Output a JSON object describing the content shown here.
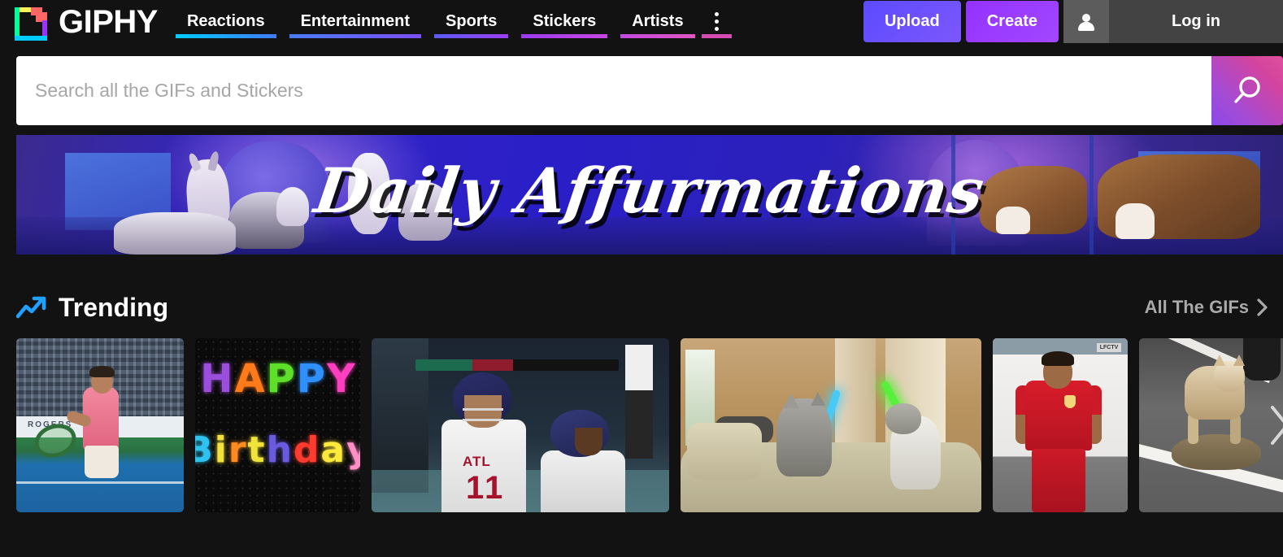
{
  "brand": {
    "name": "GIPHY",
    "logo_icon": "giphy-logo-icon"
  },
  "nav": {
    "items": [
      {
        "label": "Reactions",
        "gradient_from": "#00ccff",
        "gradient_to": "#3f7cf5"
      },
      {
        "label": "Entertainment",
        "gradient_from": "#4a7bf7",
        "gradient_to": "#7b4ff0"
      },
      {
        "label": "Sports",
        "gradient_from": "#5b5bf5",
        "gradient_to": "#9b3ff0"
      },
      {
        "label": "Stickers",
        "gradient_from": "#9a3cf2",
        "gradient_to": "#c747df"
      },
      {
        "label": "Artists",
        "gradient_from": "#c34ae0",
        "gradient_to": "#e055c0"
      }
    ],
    "more_menu": {
      "icon": "three-dots-vertical-icon",
      "underline": "#d44bb4"
    }
  },
  "header": {
    "upload_label": "Upload",
    "create_label": "Create",
    "login_label": "Log in",
    "avatar_icon": "user-avatar-icon",
    "upload_color": "#6157ff",
    "create_color": "#9933ff"
  },
  "search": {
    "placeholder": "Search all the GIFs and Stickers",
    "value": "",
    "button_icon": "search-icon",
    "button_gradient_from": "#e0519c",
    "button_gradient_to": "#8a4ae8"
  },
  "banner": {
    "title": "Daily Affurmations",
    "background_color": "#2a1fc7"
  },
  "trending": {
    "icon": "trending-arrow-icon",
    "icon_color": "#1fa2ff",
    "title": "Trending",
    "all_link_label": "All The GIFs",
    "all_link_icon": "chevron-right-icon",
    "next_icon": "carousel-next-icon",
    "cards": [
      {
        "name": "tennis-player-gif",
        "alt": "Tennis player in pink shirt on blue court",
        "banner_text": "ROGERS"
      },
      {
        "name": "happy-birthday-gif",
        "alt": "Neon Happy Birthday letters",
        "line1": [
          "H",
          "A",
          "P",
          "P",
          "Y"
        ],
        "line1_colors": [
          "#9b4ddb",
          "#ff7a1a",
          "#5ee02a",
          "#2f8fff",
          "#ff3ec0"
        ],
        "line2": [
          "B",
          "i",
          "r",
          "t",
          "h",
          "d",
          "a",
          "y"
        ],
        "line2_colors": [
          "#2fc2f0",
          "#f2e23a",
          "#ff8a1f",
          "#f0e43a",
          "#6a5ae0",
          "#ff3b2f",
          "#ffe93a",
          "#ff8fc6"
        ]
      },
      {
        "name": "football-atl-gif",
        "alt": "Atlanta Falcons players",
        "jersey_team": "ATL",
        "jersey_number": "11"
      },
      {
        "name": "cats-lightsaber-gif",
        "alt": "Two cats dueling with lightsabers on a couch"
      },
      {
        "name": "footballer-red-gif",
        "alt": "Footballer in red Liverpool kit",
        "tv_tag": "LFCTV"
      },
      {
        "name": "dog-tortoise-gif",
        "alt": "Shiba Inu dog riding a tortoise on a road"
      }
    ]
  }
}
